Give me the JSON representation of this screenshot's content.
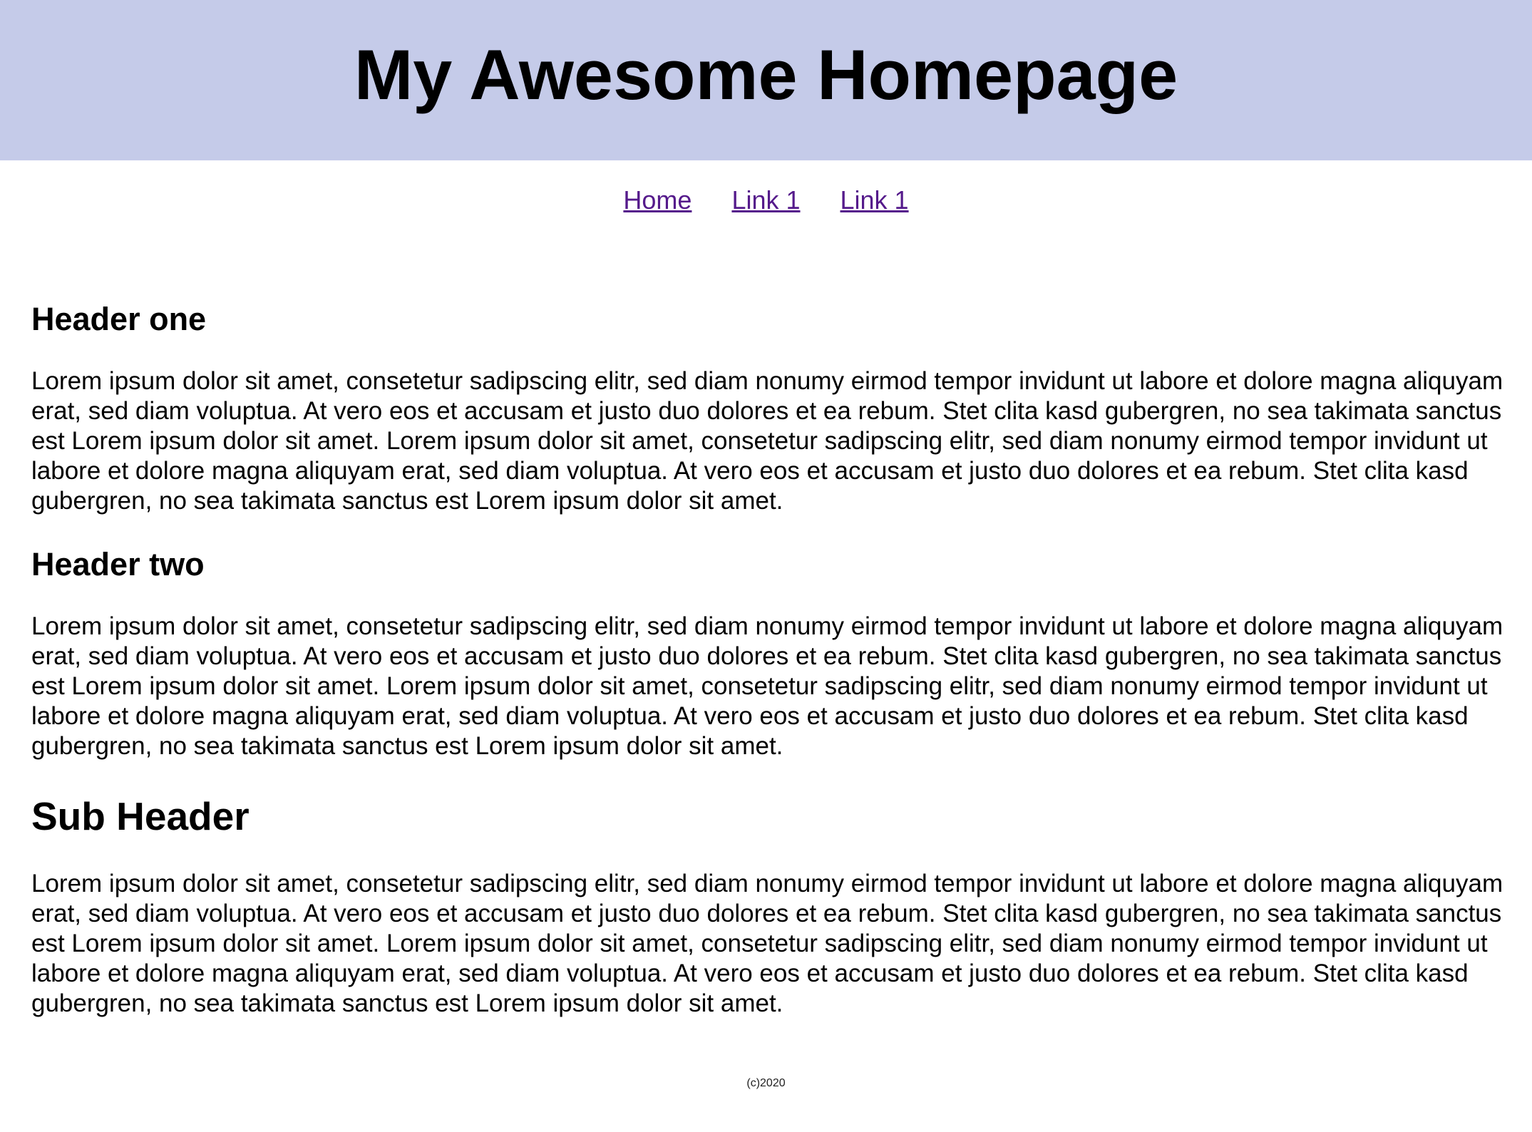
{
  "header": {
    "title": "My Awesome Homepage"
  },
  "nav": {
    "items": [
      {
        "label": "Home"
      },
      {
        "label": "Link 1"
      },
      {
        "label": "Link 1"
      }
    ]
  },
  "sections": [
    {
      "heading": "Header one",
      "body": "Lorem ipsum dolor sit amet, consetetur sadipscing elitr, sed diam nonumy eirmod tempor invidunt ut labore et dolore magna aliquyam erat, sed diam voluptua. At vero eos et accusam et justo duo dolores et ea rebum. Stet clita kasd gubergren, no sea takimata sanctus est Lorem ipsum dolor sit amet. Lorem ipsum dolor sit amet, consetetur sadipscing elitr, sed diam nonumy eirmod tempor invidunt ut labore et dolore magna aliquyam erat, sed diam voluptua. At vero eos et accusam et justo duo dolores et ea rebum. Stet clita kasd gubergren, no sea takimata sanctus est Lorem ipsum dolor sit amet."
    },
    {
      "heading": "Header two",
      "body": "Lorem ipsum dolor sit amet, consetetur sadipscing elitr, sed diam nonumy eirmod tempor invidunt ut labore et dolore magna aliquyam erat, sed diam voluptua. At vero eos et accusam et justo duo dolores et ea rebum. Stet clita kasd gubergren, no sea takimata sanctus est Lorem ipsum dolor sit amet. Lorem ipsum dolor sit amet, consetetur sadipscing elitr, sed diam nonumy eirmod tempor invidunt ut labore et dolore magna aliquyam erat, sed diam voluptua. At vero eos et accusam et justo duo dolores et ea rebum. Stet clita kasd gubergren, no sea takimata sanctus est Lorem ipsum dolor sit amet."
    },
    {
      "heading": "Sub Header",
      "body": "Lorem ipsum dolor sit amet, consetetur sadipscing elitr, sed diam nonumy eirmod tempor invidunt ut labore et dolore magna aliquyam erat, sed diam voluptua. At vero eos et accusam et justo duo dolores et ea rebum. Stet clita kasd gubergren, no sea takimata sanctus est Lorem ipsum dolor sit amet. Lorem ipsum dolor sit amet, consetetur sadipscing elitr, sed diam nonumy eirmod tempor invidunt ut labore et dolore magna aliquyam erat, sed diam voluptua. At vero eos et accusam et justo duo dolores et ea rebum. Stet clita kasd gubergren, no sea takimata sanctus est Lorem ipsum dolor sit amet."
    }
  ],
  "footer": {
    "text": "(c)2020"
  },
  "colors": {
    "header_background": "#c5cbe9",
    "link": "#551a8b"
  }
}
